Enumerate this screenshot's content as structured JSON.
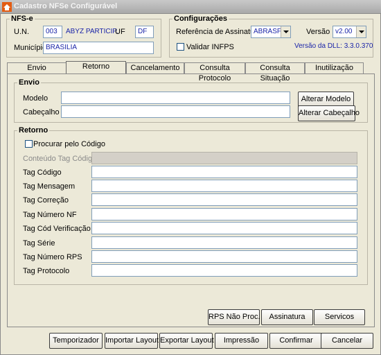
{
  "window": {
    "title": "Cadastro NFSe Configurável"
  },
  "nfse": {
    "legend": "NFS-e",
    "un_label": "U.N.",
    "un_code": "003",
    "un_name": "ABYZ PARTICIP.",
    "uf_label": "UF",
    "uf_value": "DF",
    "municipio_label": "Município",
    "municipio_value": "BRASILIA"
  },
  "config": {
    "legend": "Configurações",
    "ref_label": "Referência de Assinatura",
    "ref_value": "ABRASF",
    "versao_label": "Versão",
    "versao_value": "v2.00",
    "validar_label": "Validar INFPS",
    "dll_version": "Versão da DLL: 3.3.0.370"
  },
  "tabs": [
    "Envio",
    "Retorno",
    "Cancelamento",
    "Consulta Protocolo",
    "Consulta Situação",
    "Inutilização"
  ],
  "envio": {
    "legend": "Envio",
    "modelo_label": "Modelo",
    "modelo_value": "",
    "cabecalho_label": "Cabeçalho",
    "cabecalho_value": "",
    "btn_alterar_modelo": "Alterar Modelo",
    "btn_alterar_cabecalho": "Alterar Cabeçalho"
  },
  "retorno": {
    "legend": "Retorno",
    "procurar_label": "Procurar pelo Código",
    "conteudo_label": "Conteúdo Tag Código",
    "fields": [
      {
        "label": "Tag Código",
        "value": ""
      },
      {
        "label": "Tag Mensagem",
        "value": ""
      },
      {
        "label": "Tag Correção",
        "value": ""
      },
      {
        "label": "Tag Número NF",
        "value": ""
      },
      {
        "label": "Tag Cód Verificação",
        "value": ""
      },
      {
        "label": "Tag Série",
        "value": ""
      },
      {
        "label": "Tag Número RPS",
        "value": ""
      },
      {
        "label": "Tag Protocolo",
        "value": ""
      }
    ]
  },
  "panel_buttons": {
    "rps": "RPS Não Proc.",
    "assinatura": "Assinatura",
    "servicos": "Servicos"
  },
  "bottom_buttons": [
    "Temporizador",
    "Importar Layout",
    "Exportar Layout",
    "Impressão",
    "Confirmar",
    "Cancelar"
  ]
}
